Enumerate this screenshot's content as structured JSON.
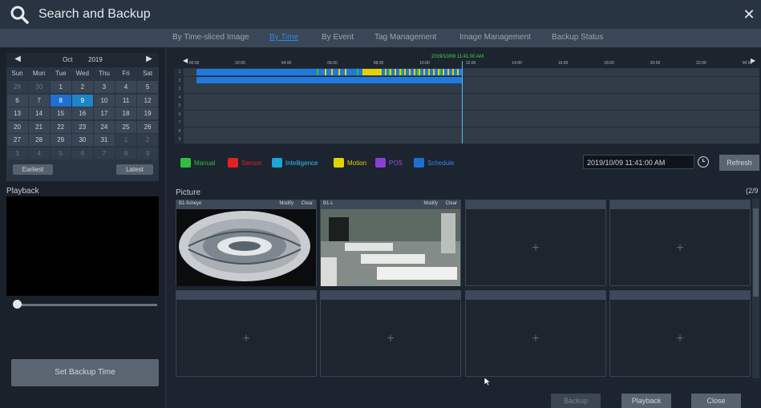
{
  "window": {
    "title": "Search and Backup"
  },
  "tabs": [
    {
      "label": "By Time-sliced Image"
    },
    {
      "label": "By Time",
      "active": true
    },
    {
      "label": "By Event"
    },
    {
      "label": "Tag Management"
    },
    {
      "label": "Image Management"
    },
    {
      "label": "Backup Status"
    }
  ],
  "calendar": {
    "month": "Oct",
    "year": "2019",
    "weekdays": [
      "Sun",
      "Mon",
      "Tue",
      "Wed",
      "Thu",
      "Fri",
      "Sat"
    ],
    "days": [
      [
        "29",
        "30",
        "1",
        "2",
        "3",
        "4",
        "5"
      ],
      [
        "6",
        "7",
        "8",
        "9",
        "10",
        "11",
        "12"
      ],
      [
        "13",
        "14",
        "15",
        "16",
        "17",
        "18",
        "19"
      ],
      [
        "20",
        "21",
        "22",
        "23",
        "24",
        "25",
        "26"
      ],
      [
        "27",
        "28",
        "29",
        "30",
        "31",
        "1",
        "2"
      ],
      [
        "3",
        "4",
        "5",
        "6",
        "7",
        "8",
        "9"
      ]
    ],
    "selected_day": "8",
    "highlighted_day": "9",
    "earliest_label": "Earliest",
    "latest_label": "Latest"
  },
  "playback": {
    "label": "Playback",
    "set_backup_label": "Set Backup Time"
  },
  "timeline": {
    "ticks": [
      "00:00",
      "02:00",
      "04:00",
      "06:00",
      "08:00",
      "10:00",
      "12:00",
      "14:00",
      "16:00",
      "18:00",
      "20:00",
      "22:00",
      "00:00"
    ],
    "cursor_time": "2019/10/09 11:41:00 AM",
    "rows": [
      "1",
      "2",
      "3",
      "4",
      "5",
      "6",
      "7",
      "8",
      "9"
    ]
  },
  "legend": [
    {
      "label": "Manual",
      "color": "#2fbf3a",
      "text_color": "#2fbf3a"
    },
    {
      "label": "Sensor",
      "color": "#e52020",
      "text_color": "#e52020"
    },
    {
      "label": "Intelligence",
      "color": "#19a6d8",
      "text_color": "#2fc0f0"
    },
    {
      "label": "Motion",
      "color": "#e4d200",
      "text_color": "#e4d200"
    },
    {
      "label": "POS",
      "color": "#8a3fd1",
      "text_color": "#9a52e0"
    },
    {
      "label": "Schedule",
      "color": "#1f6fd1",
      "text_color": "#2f86e8"
    }
  ],
  "datetime_value": "2019/10/09 11:41:00 AM",
  "refresh_label": "Refresh",
  "picture": {
    "label": "Picture",
    "page": "(2/9",
    "cells": [
      {
        "name": "B1-fisheye",
        "modify": "Modify",
        "clear": "Clear",
        "has_image": true
      },
      {
        "name": "B1-L",
        "modify": "Modify",
        "clear": "Clear",
        "has_image": true
      },
      {
        "name": "",
        "has_image": false,
        "plus": "+"
      },
      {
        "name": "",
        "has_image": false,
        "plus": "+"
      },
      {
        "name": "",
        "has_image": false,
        "plus": "+"
      },
      {
        "name": "",
        "has_image": false,
        "plus": "+"
      },
      {
        "name": "",
        "has_image": false,
        "plus": "+"
      },
      {
        "name": "",
        "has_image": false,
        "plus": "+"
      }
    ]
  },
  "bottom_buttons": {
    "backup": "Backup",
    "playback": "Playback",
    "close": "Close"
  }
}
